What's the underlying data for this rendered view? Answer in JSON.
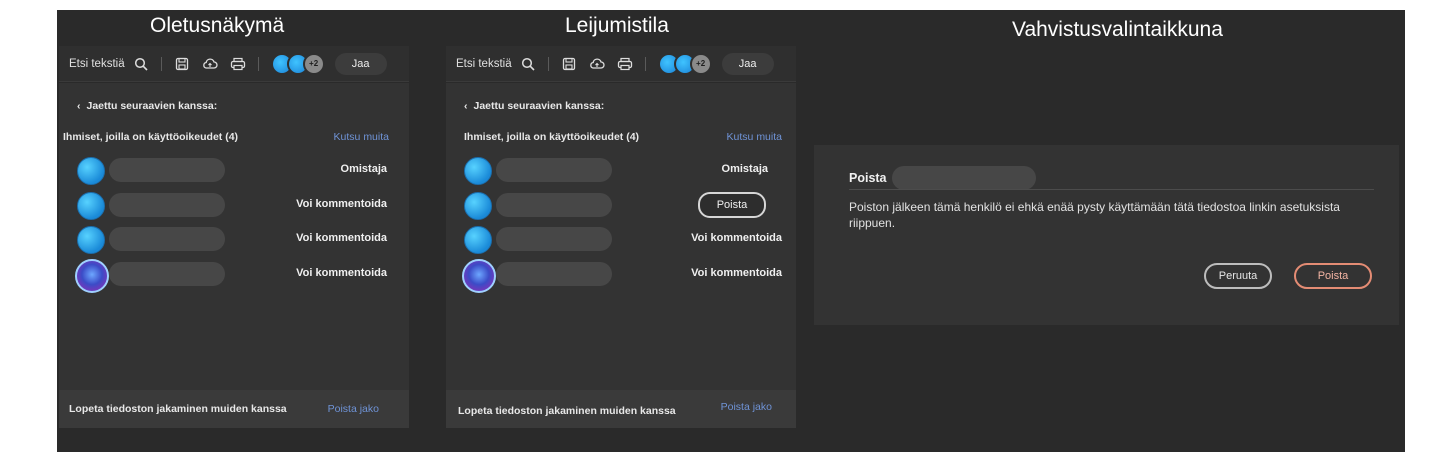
{
  "headings": {
    "default": "Oletusnäkymä",
    "hover": "Leijumistila",
    "confirm": "Vahvistusvalintaikkuna"
  },
  "toolbar": {
    "search_label": "Etsi tekstiä",
    "search_icon": "search-icon",
    "save_icon": "save-icon",
    "cloud_icon": "cloud-upload-icon",
    "print_icon": "print-icon",
    "more_count": "+2",
    "share_label": "Jaa"
  },
  "panel": {
    "back_label": "Jaettu seuraavien kanssa:",
    "people_label": "Ihmiset, joilla on käyttöoikeudet (4)",
    "invite_label": "Kutsu muita",
    "footer_text": "Lopeta tiedoston jakaminen muiden kanssa",
    "footer_link": "Poista jako"
  },
  "default_people": [
    {
      "role": "Omistaja"
    },
    {
      "role": "Voi kommentoida"
    },
    {
      "role": "Voi kommentoida"
    },
    {
      "role": "Voi kommentoida"
    }
  ],
  "hover_people": [
    {
      "role": "Omistaja"
    },
    {
      "role": "Poista"
    },
    {
      "role": "Voi kommentoida"
    },
    {
      "role": "Voi kommentoida"
    }
  ],
  "dialog": {
    "title": "Poista",
    "message": "Poiston jälkeen tämä henkilö ei ehkä enää pysty käyttämään tätä tiedostoa linkin asetuksista riippuen.",
    "cancel_label": "Peruuta",
    "delete_label": "Poista"
  },
  "colors": {
    "link": "#6f93d6",
    "delete_accent": "#e48c74",
    "background": "#2a2a2a"
  }
}
